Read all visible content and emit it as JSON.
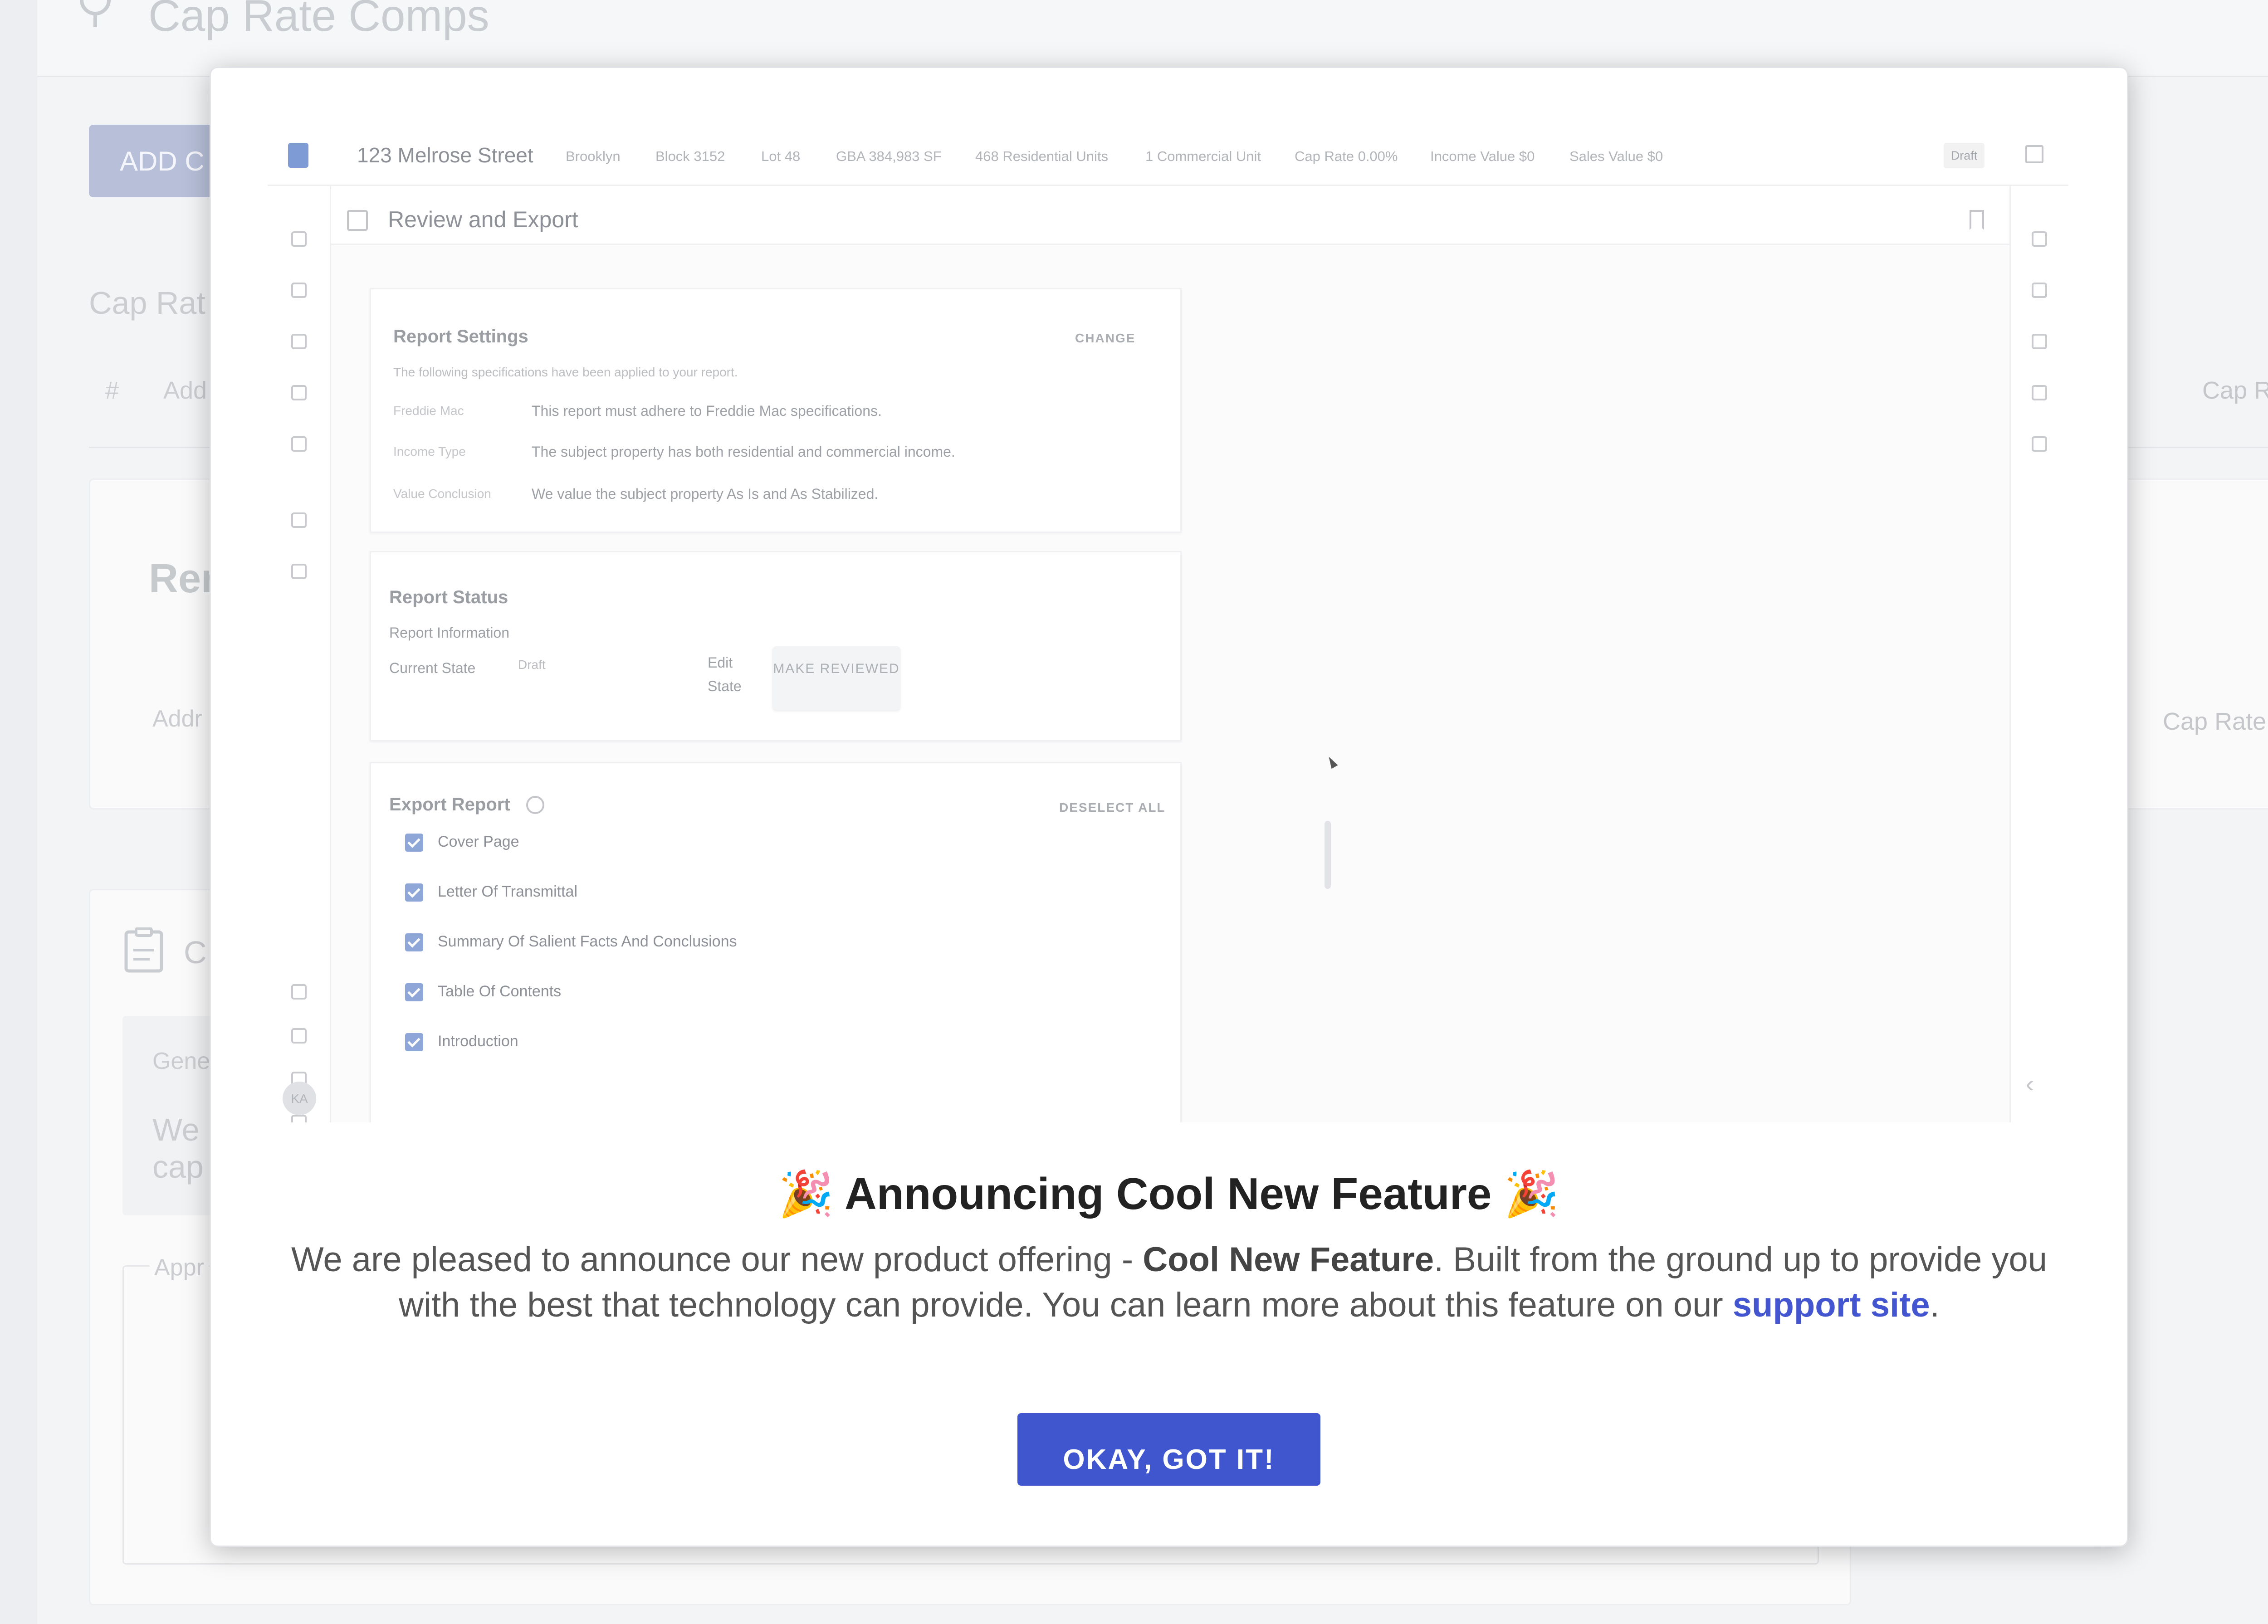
{
  "background": {
    "page_title": "Cap Rate Comps",
    "add_button": "ADD C",
    "section_title": "Cap Rat",
    "table_header_hash": "#",
    "table_header_add": "Add",
    "cap_rate_header": "Cap Rate",
    "card_title": "Ren",
    "card_addr": "Addr",
    "card_cap_rate": "Cap Rate",
    "section2_title": "C",
    "general_label": "Gene",
    "general_text_1": "We",
    "general_text_2": "cap",
    "appr_label": "Appr"
  },
  "screenshot": {
    "property": "123 Melrose Street",
    "meta": [
      "Brooklyn",
      "Block 3152",
      "Lot 48",
      "GBA 384,983 SF",
      "468 Residential Units",
      "1 Commercial Unit",
      "Cap Rate 0.00%",
      "Income Value $0",
      "Sales Value $0"
    ],
    "status_badge": "Draft",
    "page_heading": "Review and Export",
    "avatar_initials": "KA",
    "report_settings": {
      "title": "Report Settings",
      "change": "CHANGE",
      "subtitle": "The following specifications have been applied to your report.",
      "rows": [
        {
          "label": "Freddie Mac",
          "value": "This report must adhere to Freddie Mac specifications."
        },
        {
          "label": "Income Type",
          "value": "The subject property has both residential and commercial income."
        },
        {
          "label": "Value Conclusion",
          "value": "We value the subject property As Is and As Stabilized."
        }
      ]
    },
    "report_status": {
      "title": "Report Status",
      "info": "Report Information",
      "current_state_label": "Current State",
      "current_state_value": "Draft",
      "edit_state_label": "Edit State",
      "make_reviewed": "MAKE REVIEWED"
    },
    "export_report": {
      "title": "Export Report",
      "deselect_all": "DESELECT ALL",
      "items": [
        "Cover Page",
        "Letter Of Transmittal",
        "Summary Of Salient Facts And Conclusions",
        "Table Of Contents",
        "Introduction"
      ]
    }
  },
  "announcement": {
    "party_emoji": "🎉",
    "title": "Announcing Cool New Feature",
    "text_before": "We are pleased to announce our new product offering - ",
    "feature_name": "Cool New Feature",
    "text_after": ". Built from the ground up to provide you with the best that technology can provide. You can learn more about this feature on our ",
    "link_text": "support site",
    "text_end": ".",
    "ok_button": "OKAY, GOT IT!",
    "accent_color": "#3f56cf"
  }
}
